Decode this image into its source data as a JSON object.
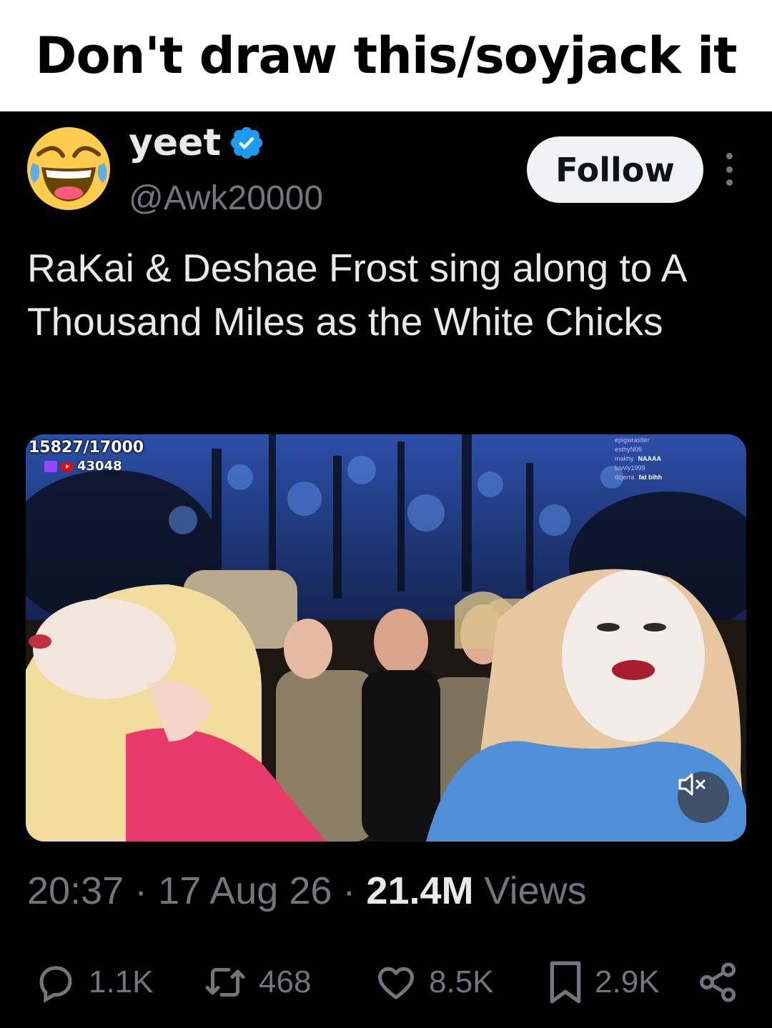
{
  "caption": "Don't draw this/soyjack it",
  "author": {
    "name": "yeet",
    "handle": "@Awk20000",
    "avatar_icon": "laughing-face-emoji",
    "verified": true
  },
  "follow_label": "Follow",
  "tweet_text": "RaKai & Deshae Frost sing along to A Thousand Miles as the White Chicks",
  "media": {
    "overlay_count": "15827/17000",
    "overlay_viewers": "43048",
    "chat": [
      {
        "user": "epigwrastler",
        "msg": ""
      },
      {
        "user": "esthyN06",
        "msg": ""
      },
      {
        "user": "makhy",
        "msg": "NAAAA"
      },
      {
        "user": "",
        "msg": ""
      },
      {
        "user": "luvvly1999",
        "msg": ""
      },
      {
        "user": "",
        "msg": ""
      },
      {
        "user": "dcjerra",
        "msg": "fat bihh"
      },
      {
        "user": "",
        "msg": ""
      }
    ],
    "muted": true
  },
  "meta": {
    "time": "20:37",
    "date": "17 Aug 26",
    "views_count": "21.4M",
    "views_label": "Views"
  },
  "stats": {
    "replies": "1.1K",
    "reposts": "468",
    "likes": "8.5K",
    "bookmarks": "2.9K"
  },
  "colors": {
    "background": "#000000",
    "text": "#e7e9ea",
    "secondary": "#71767b",
    "verified_blue": "#1d9bf0"
  }
}
